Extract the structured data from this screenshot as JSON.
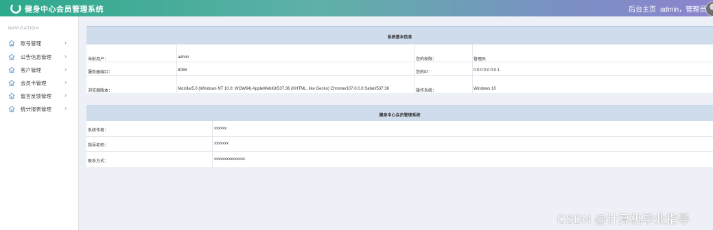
{
  "header": {
    "app_title": "健身中心会员管理系统",
    "home_link": "后台主页",
    "user": "admin，管理员"
  },
  "sidebar": {
    "title": "NAVIGATION",
    "items": [
      {
        "label": "账号管理"
      },
      {
        "label": "公告信息管理"
      },
      {
        "label": "客户管理"
      },
      {
        "label": "会员卡管理"
      },
      {
        "label": "留言反馈管理"
      },
      {
        "label": "统计报表管理"
      }
    ]
  },
  "system_info": {
    "title": "系统基本信息",
    "rows": [
      {
        "label1": "当前用户：",
        "value1": "admin",
        "label2": "您的权限：",
        "value2": "管理员"
      },
      {
        "label1": "服务器端口：",
        "value1": "8088",
        "label2": "您的IP：",
        "value2": "0:0:0:0:0:0:0:1"
      },
      {
        "label1": "浏览器版本：",
        "value1": "Mozilla/5.0 (Windows NT 10.0; WOW64) AppleWebKit/537.36 (KHTML, like Gecko) Chrome/107.0.0.0 Safari/537.36",
        "label2": "操作系统：",
        "value2": "Windows 10"
      }
    ]
  },
  "about": {
    "title": "健身中心会员管理系统",
    "rows": [
      {
        "label": "系统作者：",
        "value": "xxxxxx"
      },
      {
        "label": "指导老师：",
        "value": "xxxxxxx"
      },
      {
        "label": "联系方式：",
        "value": "xxxxxxxxxxxxxxx"
      }
    ]
  },
  "watermark": "CSDN @计算机毕业指导",
  "colors": {
    "header_start": "#2ea98c",
    "header_end": "#8c84cf",
    "panel_head": "#cfdcec",
    "page_bg": "#eef0f8"
  }
}
